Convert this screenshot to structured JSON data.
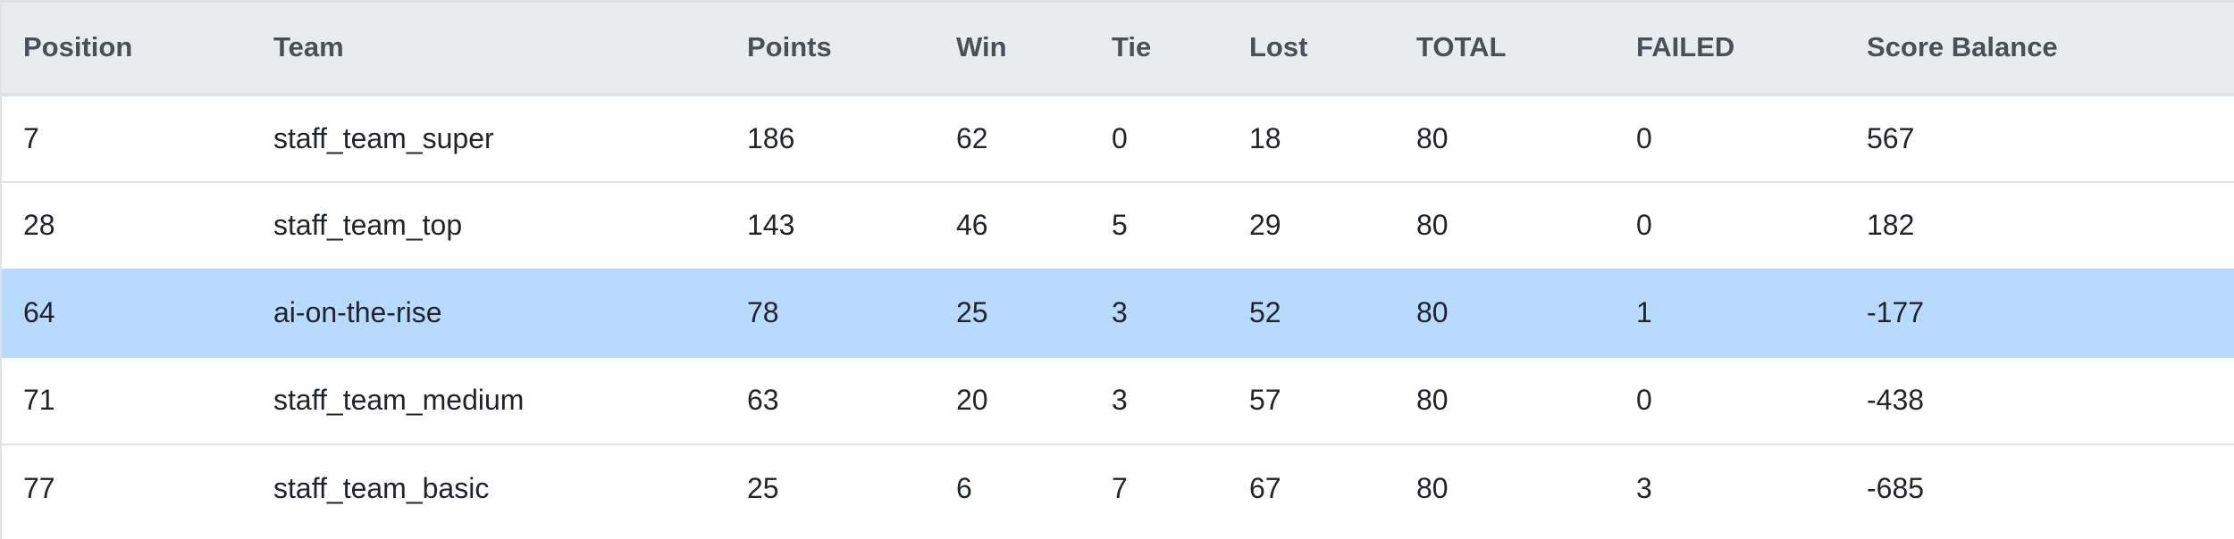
{
  "table": {
    "columns": [
      "Position",
      "Team",
      "Points",
      "Win",
      "Tie",
      "Lost",
      "TOTAL",
      "FAILED",
      "Score Balance"
    ],
    "rows": [
      {
        "position": "7",
        "team": "staff_team_super",
        "points": "186",
        "win": "62",
        "tie": "0",
        "lost": "18",
        "total": "80",
        "failed": "0",
        "score_balance": "567",
        "highlighted": false
      },
      {
        "position": "28",
        "team": "staff_team_top",
        "points": "143",
        "win": "46",
        "tie": "5",
        "lost": "29",
        "total": "80",
        "failed": "0",
        "score_balance": "182",
        "highlighted": false
      },
      {
        "position": "64",
        "team": "ai-on-the-rise",
        "points": "78",
        "win": "25",
        "tie": "3",
        "lost": "52",
        "total": "80",
        "failed": "1",
        "score_balance": "-177",
        "highlighted": true
      },
      {
        "position": "71",
        "team": "staff_team_medium",
        "points": "63",
        "win": "20",
        "tie": "3",
        "lost": "57",
        "total": "80",
        "failed": "0",
        "score_balance": "-438",
        "highlighted": false
      },
      {
        "position": "77",
        "team": "staff_team_basic",
        "points": "25",
        "win": "6",
        "tie": "7",
        "lost": "67",
        "total": "80",
        "failed": "3",
        "score_balance": "-685",
        "highlighted": false
      }
    ]
  },
  "colors": {
    "header_bg": "#e9ecef",
    "header_text": "#495057",
    "highlight_bg": "#b8daff",
    "border": "#dee2e6"
  }
}
